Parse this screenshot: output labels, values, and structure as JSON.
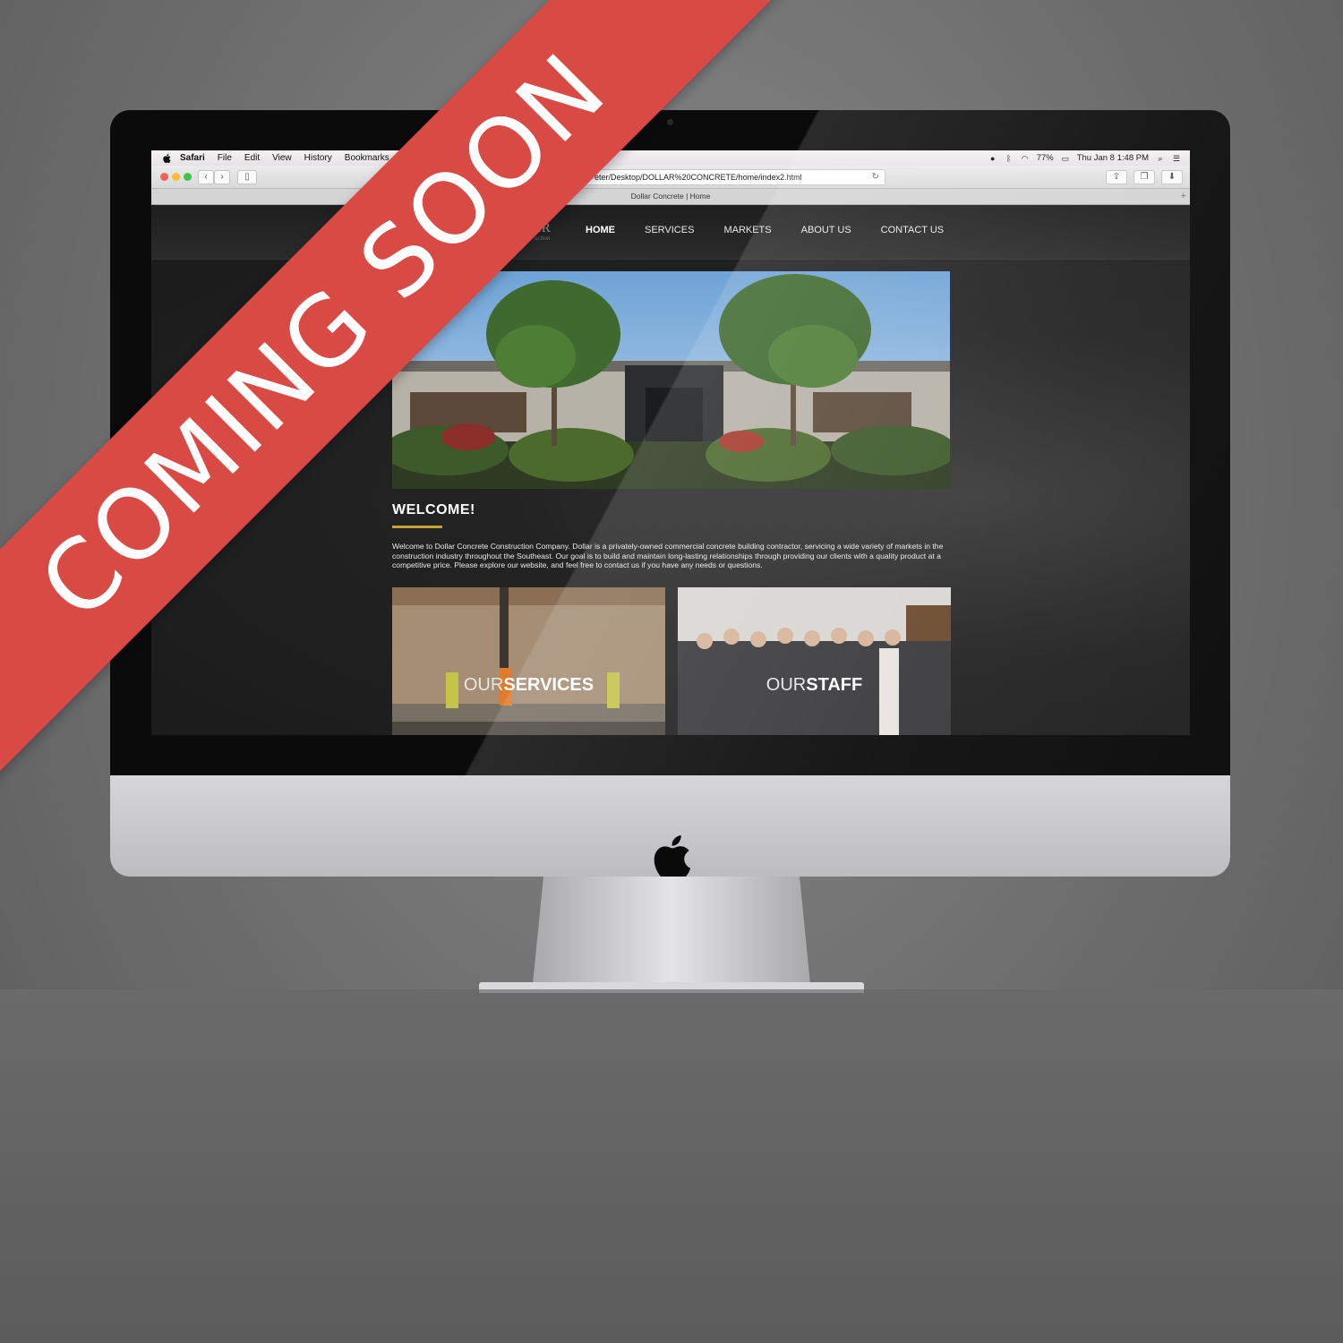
{
  "menubar": {
    "items": [
      "Safari",
      "File",
      "Edit",
      "View",
      "History",
      "Bookmarks"
    ],
    "battery": "77%",
    "clock": "Thu Jan 8  1:48 PM"
  },
  "browser": {
    "url": "Peter/Desktop/DOLLAR%20CONCRETE/home/index2.html",
    "tab_title": "Dollar Concrete | Home"
  },
  "site": {
    "logo_fragment": "AR",
    "logo_subtext": "uction",
    "nav": [
      "HOME",
      "SERVICES",
      "MARKETS",
      "ABOUT US",
      "CONTACT US"
    ],
    "welcome_title": "WELCOME!",
    "intro": "Welcome to Dollar Concrete Construction Company. Dollar is a privately-owned commercial concrete building contractor, servicing a wide variety of markets in the construction industry throughout the Southeast. Our goal is to build and maintain long-lasting relationships through providing our clients with a quality product at a competitive price. Please explore our website, and feel free to contact us if you have any needs or questions.",
    "cards": [
      {
        "light": "OUR",
        "strong": "SERVICES"
      },
      {
        "light": "OUR",
        "strong": "STAFF"
      }
    ]
  },
  "banner": {
    "text": "COMING SOON"
  },
  "colors": {
    "banner": "#d94a45",
    "accent_line": "#c9a234"
  }
}
